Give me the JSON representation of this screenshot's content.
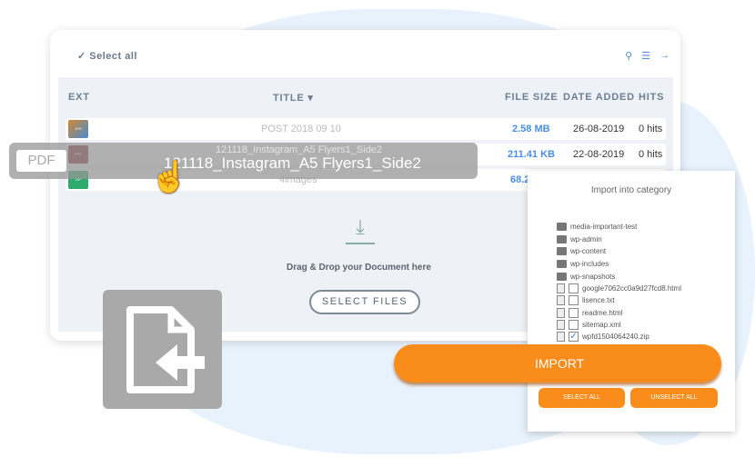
{
  "toolbar": {
    "select_all": "Select all",
    "icons": [
      "search-icon",
      "filter-icon",
      "arrow-right-icon"
    ]
  },
  "table": {
    "headers": {
      "ext": "EXT",
      "title": "TITLE ▾",
      "size": "FILE SIZE",
      "date": "DATE ADDED",
      "hits": "HITS"
    },
    "rows": [
      {
        "ext": "JPG",
        "color": "#c98a3c",
        "title": "POST 2018 09 10",
        "size": "2.58 MB",
        "date": "26-08-2019",
        "hits": "0 hits"
      },
      {
        "ext": "PDF",
        "color": "#8a2b35",
        "title": "121118_Instagram_A5 Flyers1_Side2",
        "size": "211.41 KB",
        "date": "22-08-2019",
        "hits": "0 hits"
      },
      {
        "ext": "ZIP",
        "color": "#2faa6e",
        "title": "4images",
        "size": "68.2"
      }
    ]
  },
  "drag": {
    "badge": "PDF",
    "filename": "121118_Instagram_A5 Flyers1_Side2"
  },
  "dropzone": {
    "text": "Drag & Drop your Document here",
    "button": "SELECT FILES"
  },
  "import_panel": {
    "title": "Import into category",
    "folders": [
      "media-important-test",
      "wp-admin",
      "wp-content",
      "wp-includes",
      "wp-snapshots"
    ],
    "files": [
      {
        "name": "google7062cc0a9d27fcd8.html",
        "checked": false
      },
      {
        "name": "lisence.txt",
        "checked": false
      },
      {
        "name": "readme.html",
        "checked": false
      },
      {
        "name": "sitemap.xml",
        "checked": false
      },
      {
        "name": "wpfd1504064240.zip",
        "checked": true
      }
    ],
    "import": "IMPORT",
    "select_all": "SELECT ALL",
    "unselect_all": "UNSELECT ALL"
  },
  "colors": {
    "accent": "#fa8c1c",
    "link": "#4a90e2"
  }
}
